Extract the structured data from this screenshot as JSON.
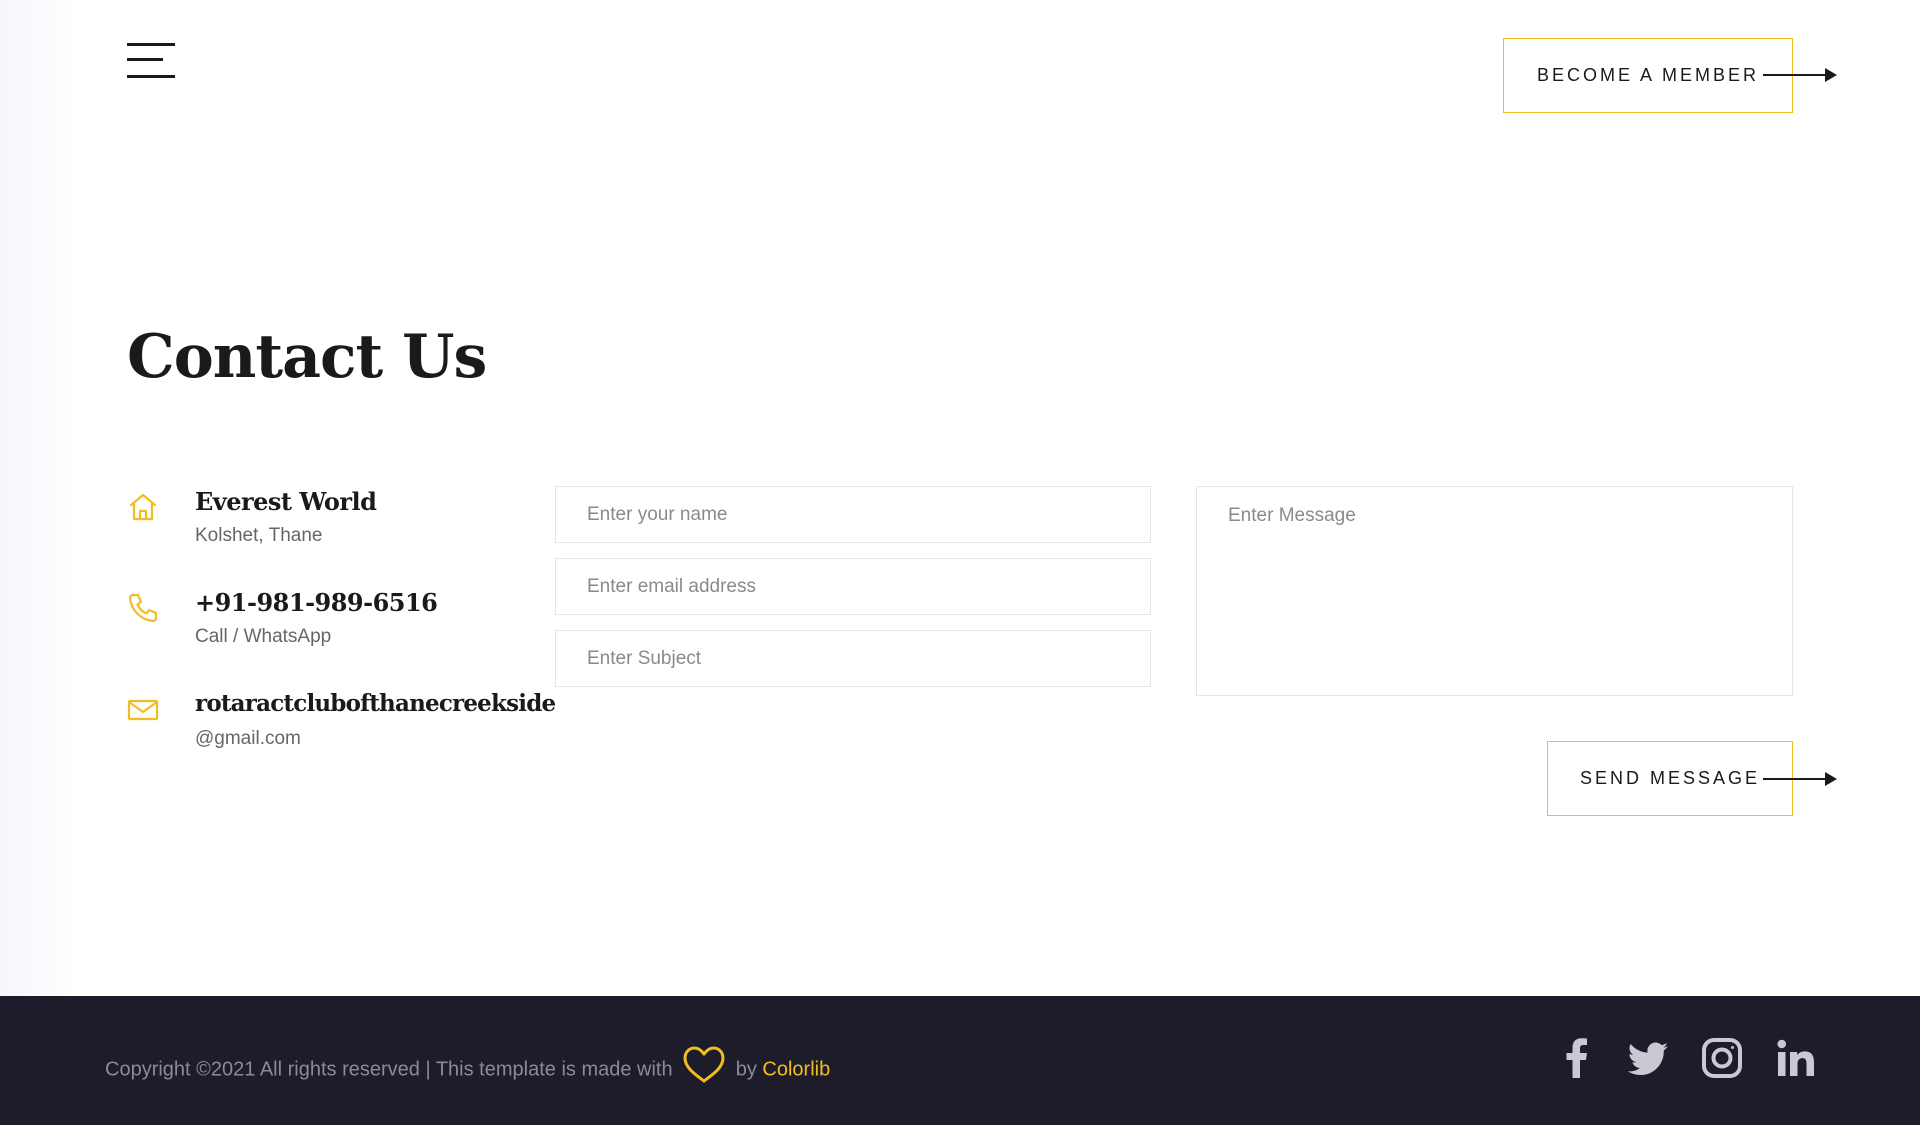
{
  "header": {
    "menu_icon": "hamburger-menu-icon",
    "become_member_label": "BECOME A MEMBER"
  },
  "main": {
    "title": "Contact Us",
    "contact_info": {
      "address": {
        "icon": "home-icon",
        "title": "Everest World",
        "subtitle": "Kolshet, Thane"
      },
      "phone": {
        "icon": "phone-icon",
        "title": "+91-981-989-6516",
        "subtitle": "Call / WhatsApp"
      },
      "email": {
        "icon": "mail-icon",
        "title": "rotaractclubofthanecreekside",
        "subtitle": "@gmail.com"
      }
    },
    "form": {
      "name_placeholder": "Enter your name",
      "email_placeholder": "Enter email address",
      "subject_placeholder": "Enter Subject",
      "message_placeholder": "Enter Message",
      "send_label": "SEND MESSAGE"
    }
  },
  "footer": {
    "copyright_text": "Copyright ©2021 All rights reserved | This template is made with",
    "by_text": "by",
    "author_link": "Colorlib",
    "social_icons": [
      "facebook-icon",
      "twitter-icon",
      "instagram-icon",
      "linkedin-icon"
    ]
  },
  "colors": {
    "accent": "#f4bd1f",
    "text_dark": "#1a1a1a",
    "text_muted": "#666666",
    "footer_bg": "#1d1c2b",
    "footer_text": "#8b8a95",
    "input_border": "#e6e6e6"
  }
}
